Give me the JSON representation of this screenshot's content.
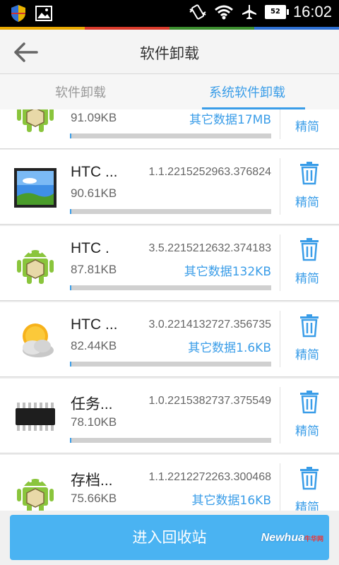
{
  "status_bar": {
    "time": "16:02",
    "battery": "52"
  },
  "header": {
    "title": "软件卸载"
  },
  "tabs": [
    {
      "label": "软件卸载"
    },
    {
      "label": "系统软件卸载"
    }
  ],
  "apps": [
    {
      "name": "",
      "version": "",
      "size": "91.09KB",
      "other_data": "其它数据17MB",
      "slim_label": "精简",
      "icon": "android-icon"
    },
    {
      "name": "HTC ...",
      "version": "1.1.2215252963.376824",
      "size": "90.61KB",
      "other_data": "",
      "slim_label": "精简",
      "icon": "gallery-icon"
    },
    {
      "name": "HTC .",
      "version": "3.5.2215212632.374183",
      "size": "87.81KB",
      "other_data": "其它数据132KB",
      "slim_label": "精简",
      "icon": "android-icon"
    },
    {
      "name": "HTC ...",
      "version": "3.0.2214132727.356735",
      "size": "82.44KB",
      "other_data": "其它数据1.6KB",
      "slim_label": "精简",
      "icon": "weather-icon"
    },
    {
      "name": "任务...",
      "version": "1.0.2215382737.375549",
      "size": "78.10KB",
      "other_data": "",
      "slim_label": "精简",
      "icon": "chip-icon"
    },
    {
      "name": "存档...",
      "version": "1.1.2212272263.300468",
      "size": "75.66KB",
      "other_data": "其它数据16KB",
      "slim_label": "精简",
      "icon": "android-icon"
    }
  ],
  "footer": {
    "recycle_label": "进入回收站"
  },
  "watermark": {
    "text": "Newhua",
    "suffix": "牛华网"
  },
  "colors": {
    "accent": "#3a9de8",
    "button": "#4ab3f2"
  }
}
